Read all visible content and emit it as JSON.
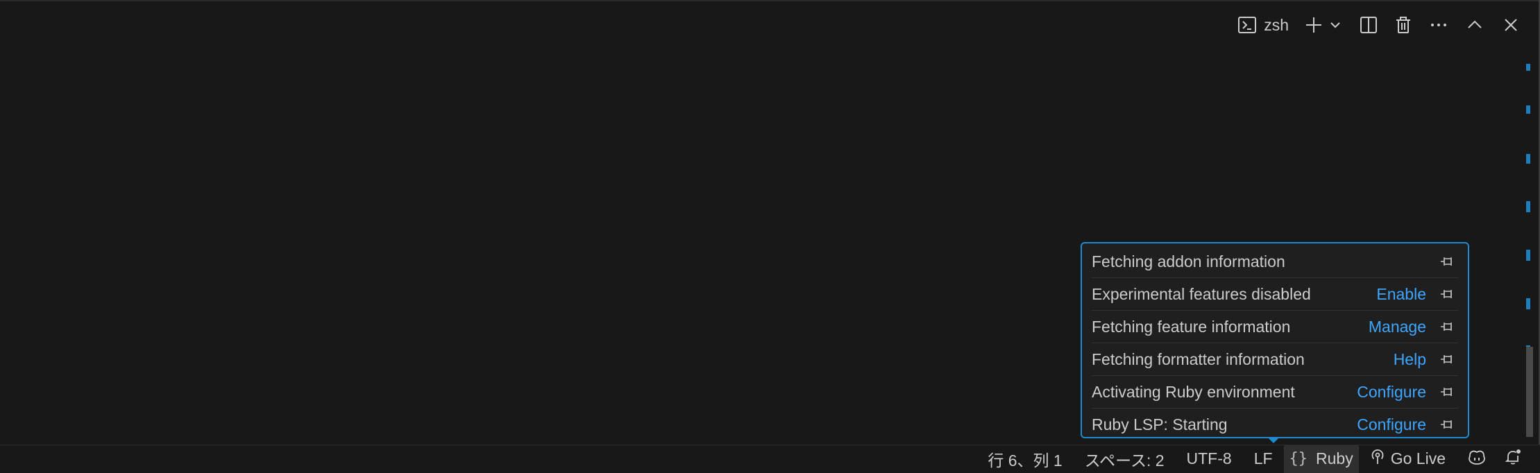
{
  "terminal": {
    "shell_label": "zsh",
    "toolbar_icons": [
      "terminal-icon",
      "plus-icon",
      "chevron-down-icon",
      "split-icon",
      "trash-icon",
      "more-icon",
      "chevron-up-icon",
      "close-icon"
    ]
  },
  "popup": {
    "items": [
      {
        "text": "Fetching addon information",
        "action": ""
      },
      {
        "text": "Experimental features disabled",
        "action": "Enable"
      },
      {
        "text": "Fetching feature information",
        "action": "Manage"
      },
      {
        "text": "Fetching formatter information",
        "action": "Help"
      },
      {
        "text": "Activating Ruby environment",
        "action": "Configure"
      },
      {
        "text": "Ruby LSP: Starting",
        "action": "Configure"
      }
    ]
  },
  "statusbar": {
    "position": "行 6、列 1",
    "indent": "スペース: 2",
    "encoding": "UTF-8",
    "eol": "LF",
    "language_icon": "{}",
    "language": "Ruby",
    "golive": "Go Live"
  },
  "colors": {
    "background": "#181818",
    "accent": "#1f8ad2",
    "link": "#3ea6ff",
    "text": "#cccccc"
  }
}
